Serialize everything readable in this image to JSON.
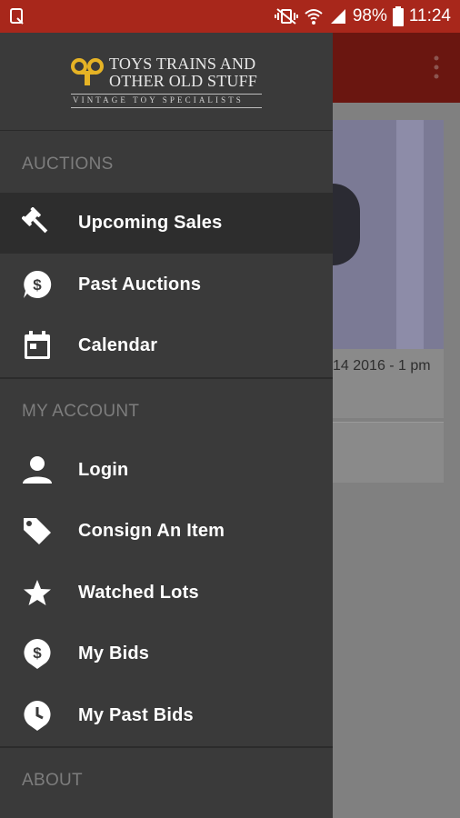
{
  "status_bar": {
    "battery": "98%",
    "time": "11:24",
    "colors": {
      "background": "#a8271b"
    }
  },
  "background_screen": {
    "card_date": "14 2016 - 1 pm"
  },
  "drawer": {
    "logo": {
      "line1": "TOYS TRAINS AND",
      "line2": "OTHER OLD STUFF",
      "tagline": "VINTAGE TOY SPECIALISTS"
    },
    "sections": [
      {
        "title": "AUCTIONS"
      },
      {
        "title": "MY ACCOUNT"
      },
      {
        "title": "ABOUT"
      }
    ],
    "auction_items": [
      {
        "label": "Upcoming Sales",
        "icon": "gavel-icon",
        "active": true
      },
      {
        "label": "Past Auctions",
        "icon": "dollar-bubble-icon"
      },
      {
        "label": "Calendar",
        "icon": "calendar-icon"
      }
    ],
    "account_items": [
      {
        "label": "Login",
        "icon": "person-icon"
      },
      {
        "label": "Consign An Item",
        "icon": "tag-icon"
      },
      {
        "label": "Watched Lots",
        "icon": "star-icon"
      },
      {
        "label": "My Bids",
        "icon": "dollar-pin-icon"
      },
      {
        "label": "My Past Bids",
        "icon": "clock-pin-icon"
      }
    ],
    "colors": {
      "background": "#3a3a3a",
      "active": "#2d2d2d",
      "section_text": "#7d7d7d",
      "logo_accent": "#e6b325"
    }
  }
}
